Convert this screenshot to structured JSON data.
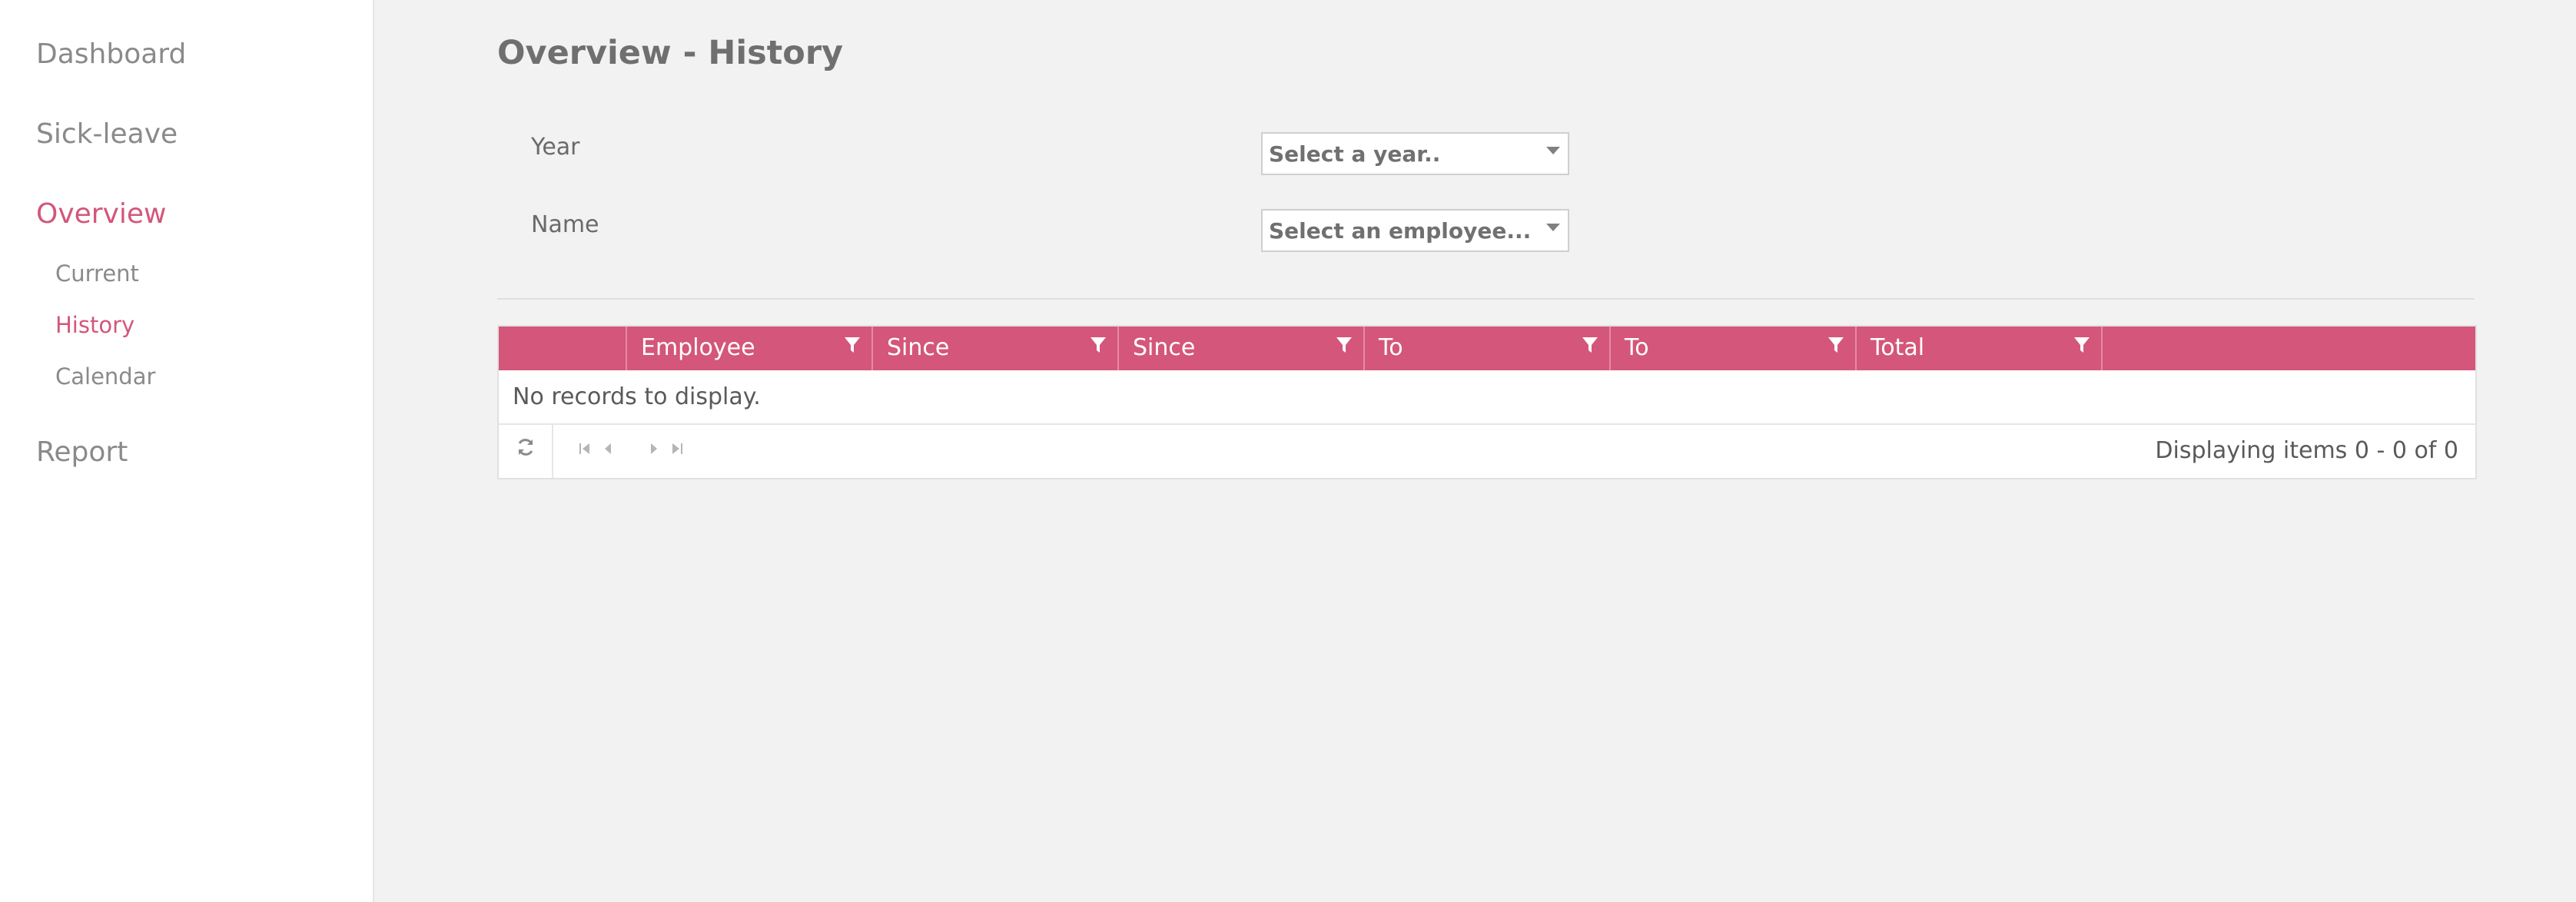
{
  "sidebar": {
    "items": [
      {
        "label": "Dashboard"
      },
      {
        "label": "Sick-leave"
      },
      {
        "label": "Overview"
      },
      {
        "label": "Report"
      }
    ],
    "subitems": [
      {
        "label": "Current"
      },
      {
        "label": "History"
      },
      {
        "label": "Calendar"
      }
    ]
  },
  "page": {
    "title": "Overview - History"
  },
  "form": {
    "year_label": "Year",
    "year_placeholder": "Select a year..",
    "name_label": "Name",
    "name_placeholder": "Select an employee..."
  },
  "grid": {
    "columns": [
      "Employee",
      "Since",
      "Since",
      "To",
      "To",
      "Total"
    ],
    "empty_message": "No records to display.",
    "pager_info": "Displaying items 0 - 0 of 0"
  },
  "colors": {
    "accent": "#d4567a",
    "text_muted": "#8a8a8a"
  },
  "icons": {
    "refresh": "refresh-icon",
    "filter": "filter-icon",
    "first": "first-page-icon",
    "prev": "prev-page-icon",
    "next": "next-page-icon",
    "last": "last-page-icon"
  }
}
